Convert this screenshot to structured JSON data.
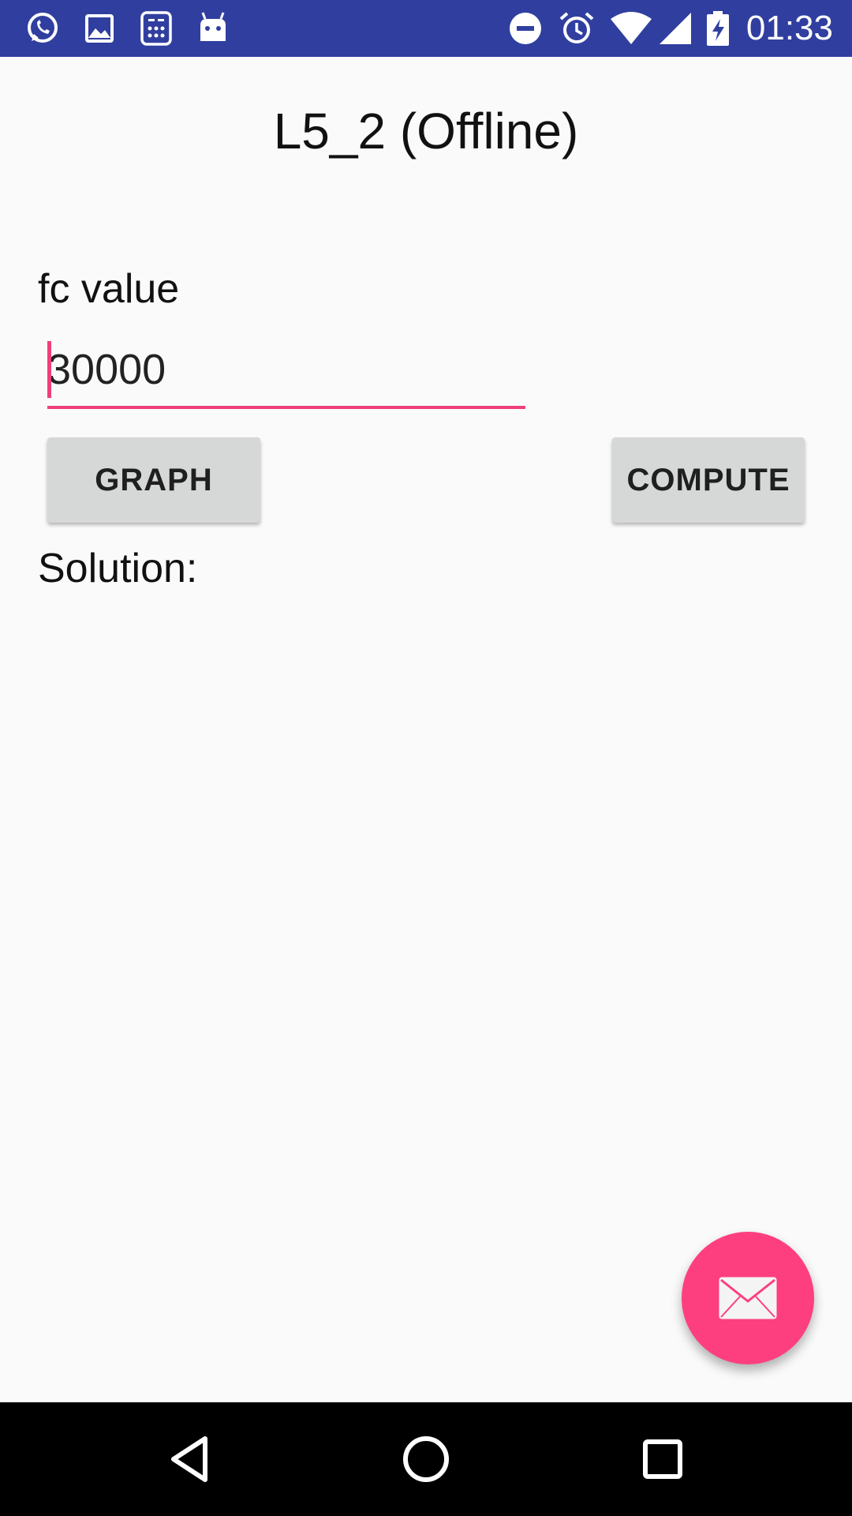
{
  "status_bar": {
    "time": "01:33",
    "left_icons": [
      "whatsapp-icon",
      "image-icon",
      "calculator-icon",
      "android-icon"
    ],
    "right_icons": [
      "do-not-disturb-icon",
      "alarm-icon",
      "wifi-icon",
      "signal-icon",
      "battery-charging-icon"
    ]
  },
  "screen": {
    "title": "L5_2 (Offline)",
    "fc_label": "fc value",
    "fc_value": "30000",
    "graph_button": "GRAPH",
    "compute_button": "COMPUTE",
    "solution_label": "Solution:"
  },
  "fab": {
    "icon": "email-icon",
    "color": "#fd3f80"
  },
  "navigation": {
    "back": "back-icon",
    "home": "home-icon",
    "recents": "recents-icon"
  },
  "colors": {
    "status_bar": "#303f9f",
    "accent": "#ef3f7d",
    "button": "#d6d7d7"
  }
}
